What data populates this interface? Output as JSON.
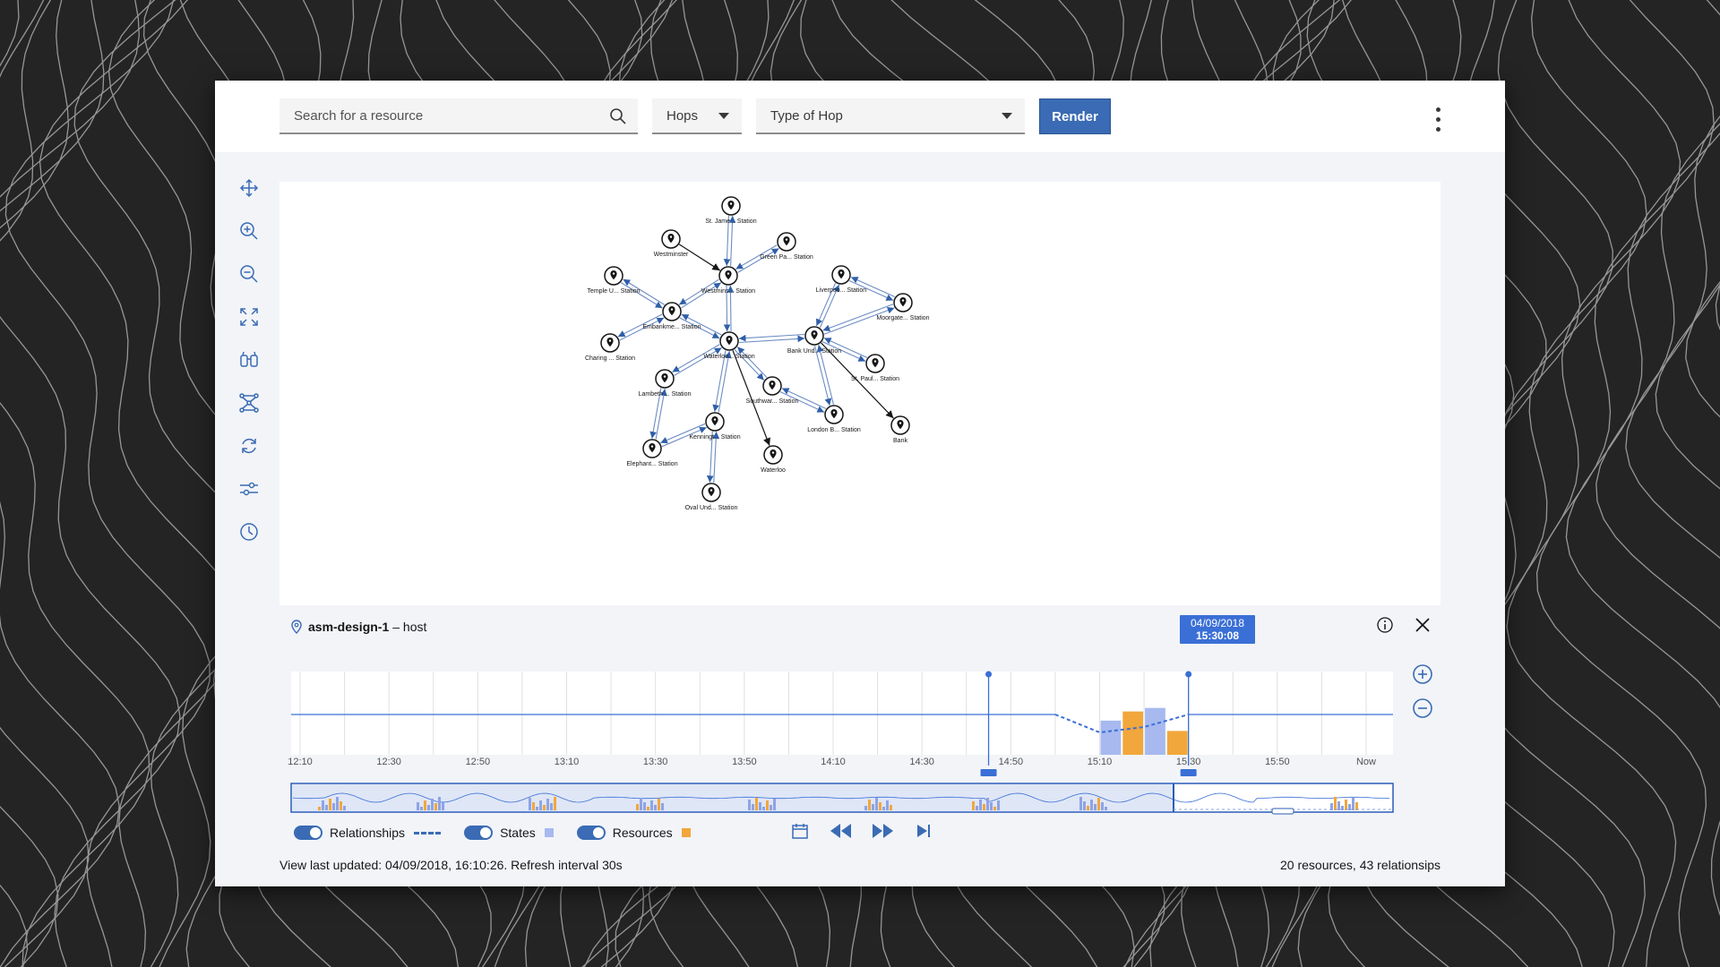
{
  "toolbar": {
    "search_placeholder": "Search for a resource",
    "hops_label": "Hops",
    "hop_type_label": "Type of Hop",
    "render_label": "Render"
  },
  "tools": [
    "move-icon",
    "zoom-in-icon",
    "zoom-out-icon",
    "fit-to-screen-icon",
    "find-binoculars-icon",
    "topology-icon",
    "refresh-icon",
    "filter-sliders-icon",
    "history-clock-icon"
  ],
  "graph": {
    "nodes": [
      {
        "id": "stjames",
        "label": "St. Jame... Station"
      },
      {
        "id": "westminster",
        "label": "Westminster"
      },
      {
        "id": "greenpark",
        "label": "Green Pa... Station"
      },
      {
        "id": "westminsterst",
        "label": "Westmins... Station"
      },
      {
        "id": "temple",
        "label": "Temple U... Station"
      },
      {
        "id": "embankment",
        "label": "Embankme... Station"
      },
      {
        "id": "charing",
        "label": "Charing ... Station"
      },
      {
        "id": "waterloost",
        "label": "Waterloo... Station"
      },
      {
        "id": "lambeth",
        "label": "Lambeth ... Station"
      },
      {
        "id": "kennington",
        "label": "Kenningt... Station"
      },
      {
        "id": "elephant",
        "label": "Elephant... Station"
      },
      {
        "id": "oval",
        "label": "Oval Und... Station"
      },
      {
        "id": "waterloo",
        "label": "Waterloo"
      },
      {
        "id": "southwark",
        "label": "Southwar... Station"
      },
      {
        "id": "londonbridge",
        "label": "London B... Station"
      },
      {
        "id": "bankund",
        "label": "Bank Und... Station"
      },
      {
        "id": "liverpool",
        "label": "Liverpoo... Station"
      },
      {
        "id": "moorgate",
        "label": "Moorgate... Station"
      },
      {
        "id": "stpaul",
        "label": "St. Paul... Station"
      },
      {
        "id": "bank",
        "label": "Bank"
      }
    ],
    "edges": [
      [
        "stjames",
        "westminsterst",
        "double"
      ],
      [
        "westminster",
        "westminsterst",
        "single"
      ],
      [
        "greenpark",
        "westminsterst",
        "double"
      ],
      [
        "westminsterst",
        "embankment",
        "double"
      ],
      [
        "westminsterst",
        "waterloost",
        "double"
      ],
      [
        "temple",
        "embankment",
        "double"
      ],
      [
        "embankment",
        "charing",
        "double"
      ],
      [
        "embankment",
        "waterloost",
        "double"
      ],
      [
        "waterloost",
        "lambeth",
        "double"
      ],
      [
        "waterloost",
        "kennington",
        "double"
      ],
      [
        "waterloost",
        "southwark",
        "double"
      ],
      [
        "waterloost",
        "waterloo",
        "single"
      ],
      [
        "waterloost",
        "bankund",
        "double"
      ],
      [
        "lambeth",
        "elephant",
        "double"
      ],
      [
        "kennington",
        "elephant",
        "double"
      ],
      [
        "kennington",
        "oval",
        "double"
      ],
      [
        "southwark",
        "londonbridge",
        "double"
      ],
      [
        "bankund",
        "londonbridge",
        "double"
      ],
      [
        "bankund",
        "liverpool",
        "double"
      ],
      [
        "bankund",
        "moorgate",
        "double"
      ],
      [
        "liverpool",
        "moorgate",
        "double"
      ],
      [
        "bankund",
        "stpaul",
        "double"
      ],
      [
        "bankund",
        "bank",
        "single"
      ]
    ]
  },
  "timeline": {
    "resource": "asm-design-1",
    "resource_type": "– host",
    "tooltip_date": "04/09/2018",
    "tooltip_time": "15:30:08",
    "ticks": [
      "12:10",
      "12:30",
      "12:50",
      "13:10",
      "13:30",
      "13:50",
      "14:10",
      "14:30",
      "14:50",
      "15:10",
      "15:30",
      "15:50",
      "Now"
    ],
    "bars": [
      {
        "time": "15:10",
        "state": 0.62,
        "resource": 0
      },
      {
        "time": "15:15",
        "state": 0,
        "resource": 1.0
      },
      {
        "time": "15:20",
        "state": 0.85,
        "resource": 0
      },
      {
        "time": "15:25",
        "state": 0,
        "resource": 0.55
      }
    ],
    "colors": {
      "state": "#a7b9ef",
      "resource": "#f1a73b",
      "line": "#3a6fd6"
    }
  },
  "legend": {
    "relationships": "Relationships",
    "states": "States",
    "resources": "Resources"
  },
  "status": {
    "updated": "View last updated: 04/09/2018, 16:10:26. Refresh interval 30s",
    "counts": "20 resources, 43 relationsips"
  }
}
